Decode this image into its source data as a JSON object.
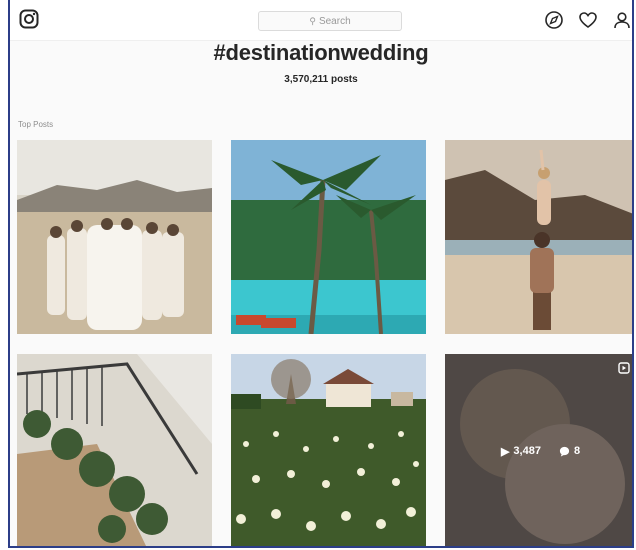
{
  "header": {
    "search_placeholder": "Search",
    "icons": [
      "instagram-logo-icon",
      "compass-icon",
      "heart-icon",
      "user-icon"
    ]
  },
  "hashtag": {
    "title": "#destinationwedding",
    "post_count": "3,570,211 posts"
  },
  "section_label": "Top Posts",
  "posts": [
    {
      "subject": "bridal party on hillside"
    },
    {
      "subject": "palm trees and turquoise water"
    },
    {
      "subject": "couple lift on beach"
    },
    {
      "subject": "staircase with greenery"
    },
    {
      "subject": "farmhouse and daffodil field"
    },
    {
      "subject": "couple close-up video",
      "views": "3,487",
      "comments": "8"
    }
  ],
  "colors": {
    "frame_border": "#2c3e88",
    "text": "#262626",
    "muted": "#8e8e8e"
  }
}
